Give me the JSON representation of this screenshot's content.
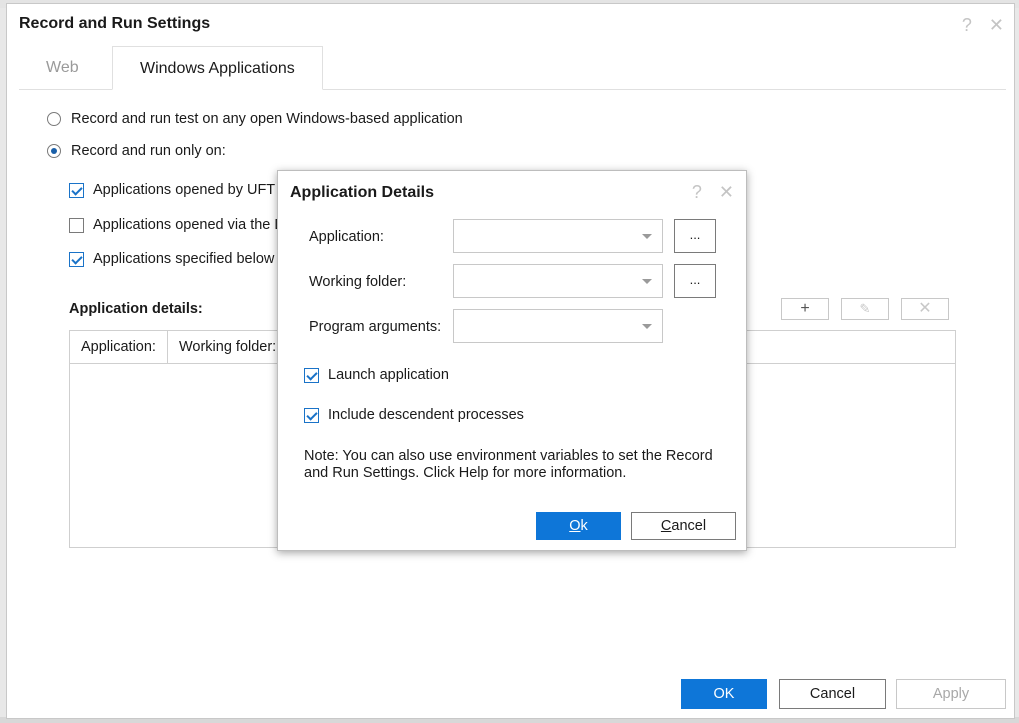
{
  "dialog": {
    "title": "Record and Run Settings",
    "help_icon": "?",
    "close_icon": "✕"
  },
  "tabs": [
    {
      "label": "Web",
      "active": false
    },
    {
      "label": "Windows Applications",
      "active": true
    }
  ],
  "options": {
    "radio_any": {
      "label": "Record and run test on any open Windows-based application",
      "checked": false
    },
    "radio_only": {
      "label": "Record and run only on:",
      "checked": true
    },
    "checks": [
      {
        "label": "Applications opened by UFT",
        "checked": true
      },
      {
        "label": "Applications opened via the D",
        "checked": false
      },
      {
        "label": "Applications specified below",
        "checked": true
      }
    ]
  },
  "details": {
    "label": "Application details:",
    "columns": [
      "Application:",
      "Working folder:"
    ],
    "toolbar": {
      "add": "+",
      "edit": "✎",
      "delete": "✕"
    }
  },
  "footer": {
    "ok": "OK",
    "cancel": "Cancel",
    "apply": "Apply"
  },
  "modal": {
    "title": "Application Details",
    "help_icon": "?",
    "close_icon": "✕",
    "application_label": "Application:",
    "application_value": "",
    "working_folder_label": "Working folder:",
    "working_folder_value": "",
    "program_args_label": "Program arguments:",
    "program_args_value": "",
    "browse": "...",
    "launch": {
      "label": "Launch application",
      "checked": true
    },
    "include": {
      "label": "Include descendent processes",
      "checked": true
    },
    "note": "Note: You can also use environment variables to set the Record and Run Settings. Click Help for more information.",
    "ok_mnemonic": "O",
    "ok_rest": "k",
    "cancel_mnemonic": "C",
    "cancel_rest": "ancel"
  },
  "colors": {
    "accent": "#0e76d8",
    "check": "#1a73c8",
    "disabled_text": "#a8a8a8"
  }
}
